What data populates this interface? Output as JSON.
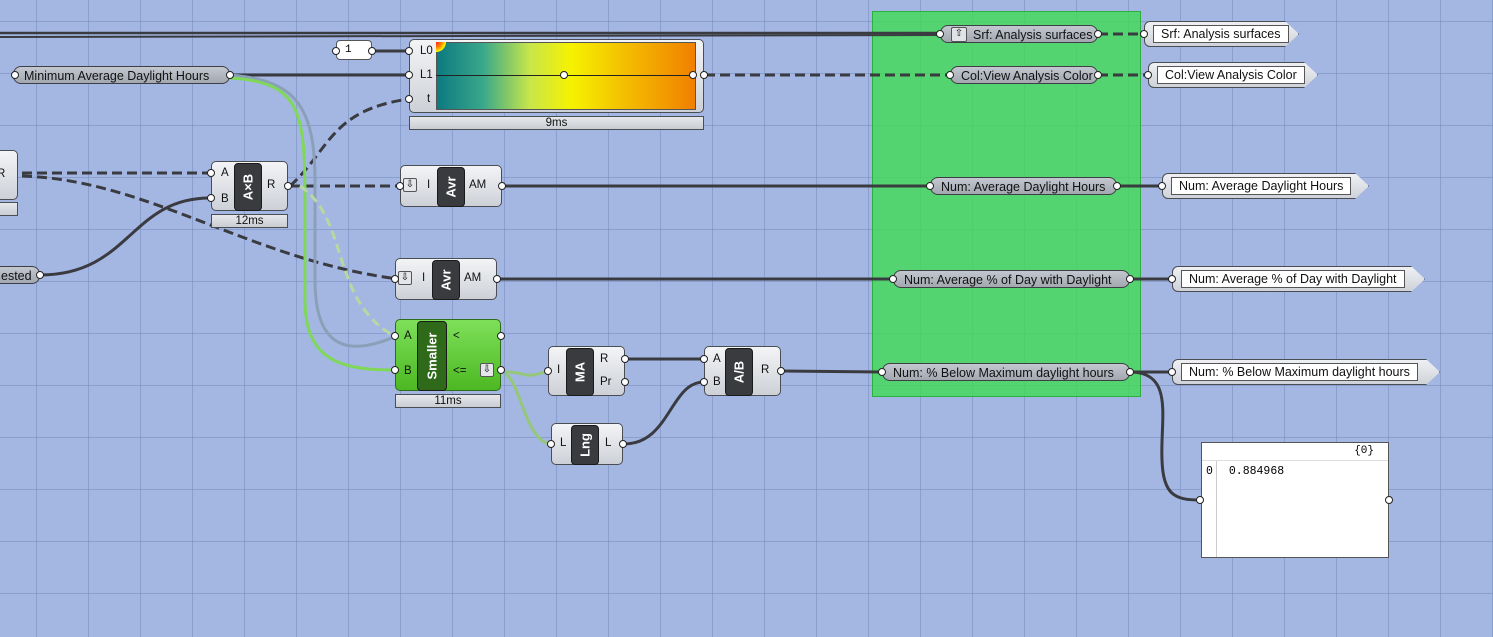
{
  "canvas": {
    "background": "#a4b7e3",
    "group_color": "#4cd86a"
  },
  "params": {
    "min_avg_daylight": "Minimum Average Daylight Hours",
    "nested": "ested",
    "srf_analysis": "Srf: Analysis surfaces",
    "col_view": "Col:View Analysis Color",
    "num_avg_daylight": "Num: Average Daylight Hours",
    "num_avg_pct": "Num: Average % of Day with Daylight",
    "num_below_max": "Num: % Below Maximum daylight hours",
    "left_r": "R"
  },
  "outputs": {
    "srf_analysis": "Srf: Analysis surfaces",
    "col_view": "Col:View Analysis Color",
    "num_avg_daylight": "Num: Average Daylight Hours",
    "num_avg_pct": "Num: Average % of Day with Daylight",
    "num_below_max": "Num: % Below Maximum daylight hours"
  },
  "slider": {
    "value": "1"
  },
  "gradient": {
    "ports": {
      "l0": "L0",
      "l1": "L1",
      "t": "t"
    },
    "time": "9ms"
  },
  "multiply": {
    "a": "A",
    "b": "B",
    "r": "R",
    "name": "A×B",
    "time": "12ms"
  },
  "avg1": {
    "i": "I",
    "name": "Avr",
    "am": "AM"
  },
  "avg2": {
    "i": "I",
    "name": "Avr",
    "am": "AM"
  },
  "smaller": {
    "a": "A",
    "b": "B",
    "lt": "<",
    "le": "<=",
    "name": "Smaller",
    "time": "11ms"
  },
  "mass_add": {
    "i": "I",
    "name": "MA",
    "r": "R",
    "pr": "Pr"
  },
  "length": {
    "l_in": "L",
    "name": "Lng",
    "l_out": "L"
  },
  "division": {
    "a": "A",
    "b": "B",
    "name": "A/B",
    "r": "R"
  },
  "panel": {
    "header": "{0}",
    "index": "0",
    "value": "0.884968"
  }
}
